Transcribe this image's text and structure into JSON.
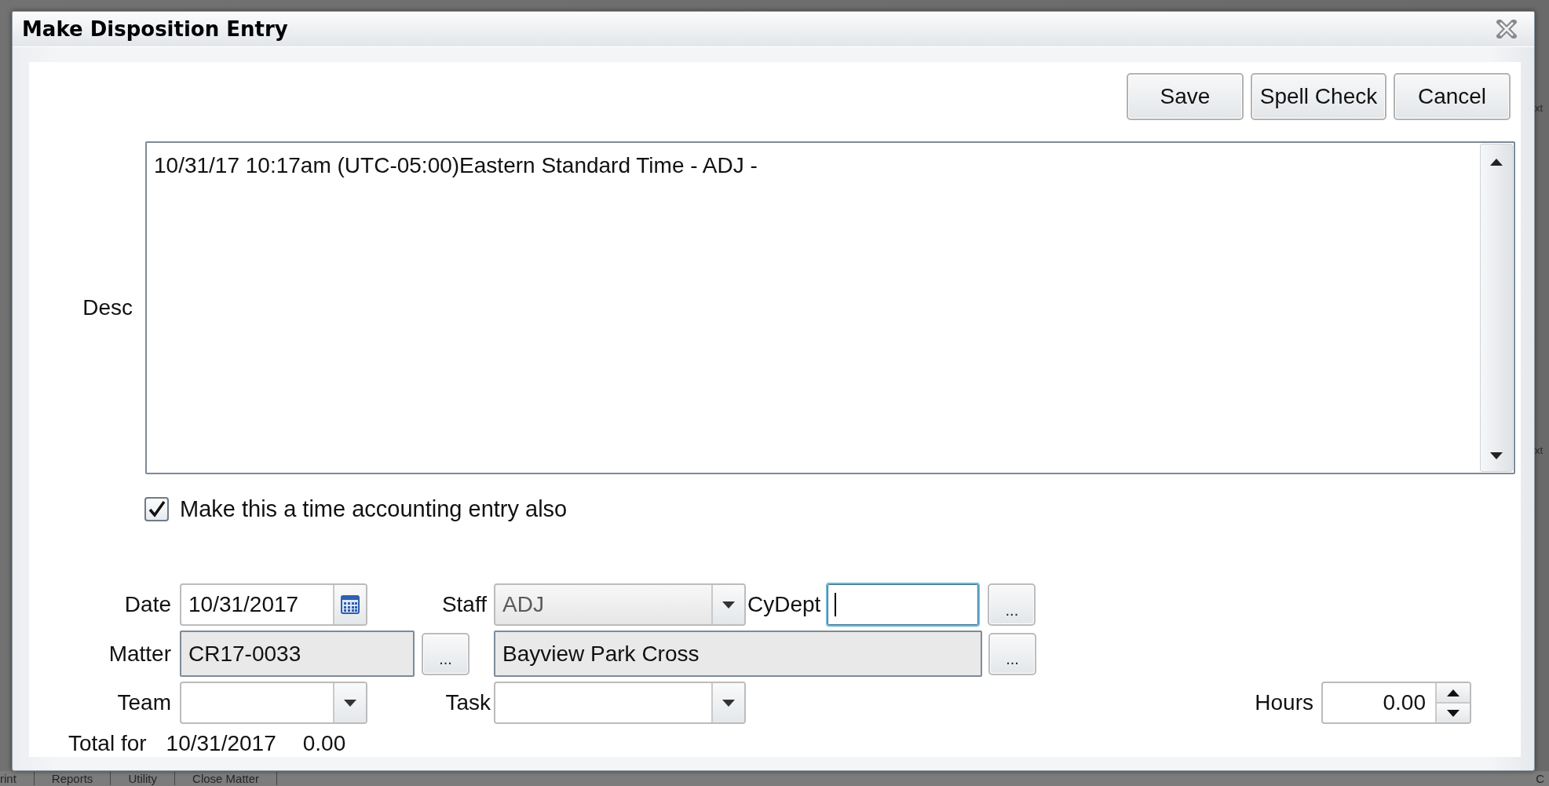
{
  "background": {
    "side_fragments": [
      "xt",
      "xt"
    ],
    "bottom_tabs": [
      "rint",
      "Reports",
      "Utility",
      "Close Matter"
    ],
    "corner_fragment": "C"
  },
  "dialog": {
    "title": "Make Disposition Entry"
  },
  "buttons": [
    {
      "label": "Save"
    },
    {
      "label": "Spell Check"
    },
    {
      "label": "Cancel"
    }
  ],
  "desc": {
    "label": "Desc",
    "value": "10/31/17 10:17am (UTC-05:00)Eastern Standard Time - ADJ -"
  },
  "time_entry": {
    "label": "Make this a time accounting entry also",
    "checked": true
  },
  "date": {
    "label": "Date",
    "value": "10/31/2017"
  },
  "staff": {
    "label": "Staff",
    "value": "ADJ",
    "disabled": true
  },
  "cydept": {
    "label": "CyDept",
    "focused": true,
    "button": "..."
  },
  "matter": {
    "label": "Matter",
    "value": "CR17-0033",
    "read_only": true,
    "button": "..."
  },
  "matter_name": {
    "value": "Bayview Park Cross",
    "read_only": true,
    "button": "..."
  },
  "team": {
    "label": "Team",
    "disabled": false
  },
  "task": {
    "label": "Task",
    "disabled": false
  },
  "hours": {
    "label": "Hours",
    "value": "0.00"
  },
  "total": {
    "label": "Total for",
    "date": "10/31/2017",
    "value": "0.00"
  }
}
